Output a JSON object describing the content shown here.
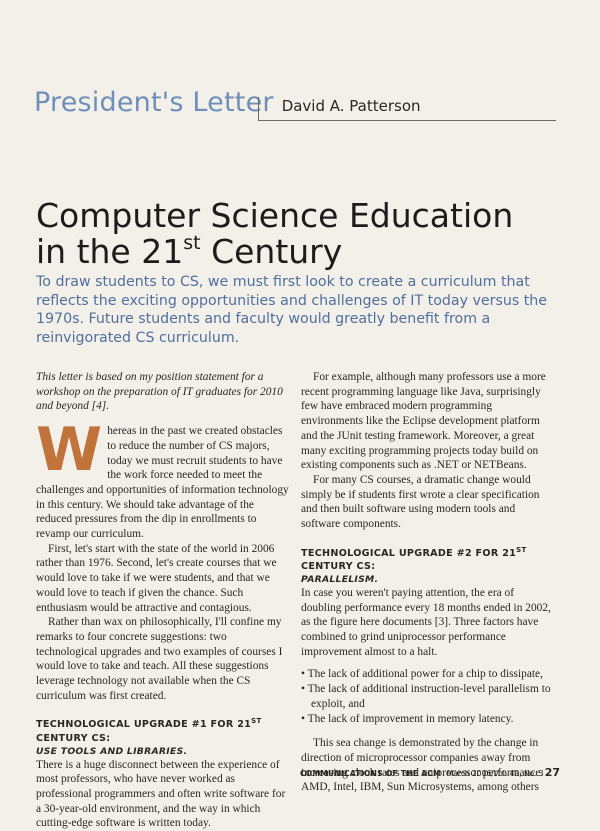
{
  "header": {
    "section": "President's Letter",
    "author": "David A. Patterson"
  },
  "title": {
    "line1": "Computer Science Education",
    "line2_pre": "in the 21",
    "line2_sup": "st",
    "line2_post": " Century"
  },
  "deck": "To draw students to CS, we must first look to create a curriculum that reflects the exciting opportunities and challenges of IT today versus the 1970s. Future students and faculty would greatly benefit from a reinvigorated CS curriculum.",
  "left": {
    "intro": "This letter is based on my position statement for a workshop on the preparation of IT graduates for 2010 and beyond [4].",
    "dropcap": "W",
    "p1": "hereas in the past we created obstacles to reduce the number of CS majors, today we must recruit students to have the work force needed to meet the challenges and opportunities of information technology in this century. We should take advantage of the reduced pressures from the dip in enrollments to revamp our curriculum.",
    "p2": "First, let's start with the state of the world in 2006 rather than 1976. Second, let's create courses that we would love to take if we were students, and that we would love to teach if given the chance. Such enthusiasm would be attractive and contagious.",
    "p3": "Rather than wax on philosophically, I'll confine my remarks to four concrete suggestions: two technological upgrades and two examples of courses I would love to take and teach. All these suggestions leverage technology not available when the CS curriculum was first created.",
    "sub1_pre": "Technological Upgrade #1 for 21",
    "sub1_sup": "st",
    "sub1_post": " Century CS:",
    "sub1_b": "Use Tools and Libraries.",
    "p4": "There is a huge disconnect between the experience of most professors, who have never worked as professional programmers and often write software for a 30-year-old environment, and the way in which cutting-edge software is written today."
  },
  "right": {
    "p1": "For example, although many professors use a more recent programming language like Java, surprisingly few have embraced modern programming environments like the Eclipse development platform and the JUnit testing framework. Moreover, a great many exciting programming projects today build on existing components such as .NET or NETBeans.",
    "p2": "For many CS courses, a dramatic change would simply be if students first wrote a clear specification and then built software using modern tools and software components.",
    "sub2_pre": "Technological Upgrade #2 for 21",
    "sub2_sup": "st",
    "sub2_post": " Century CS:",
    "sub2_b": "Parallelism.",
    "p3": "In case you weren't paying attention, the era of doubling performance every 18 months ended in 2002, as the figure here documents [3]. Three factors have combined to grind uniprocessor performance improvement almost to a halt.",
    "bullets": [
      "• The lack of additional power for a chip to dissipate,",
      "• The lack of additional instruction-level parallelism to exploit, and",
      "• The lack of improvement in memory latency."
    ],
    "p4": "This sea change is demonstrated by the change in direction of microprocessor companies away from increasing clock rates and uniprocessor performance. AMD, Intel, IBM, Sun Microsystems, among others"
  },
  "footer": {
    "publication": "COMMUNICATIONS OF THE ACM",
    "issue": "March 2006/Vol. 49, No. 3",
    "page": "27"
  }
}
